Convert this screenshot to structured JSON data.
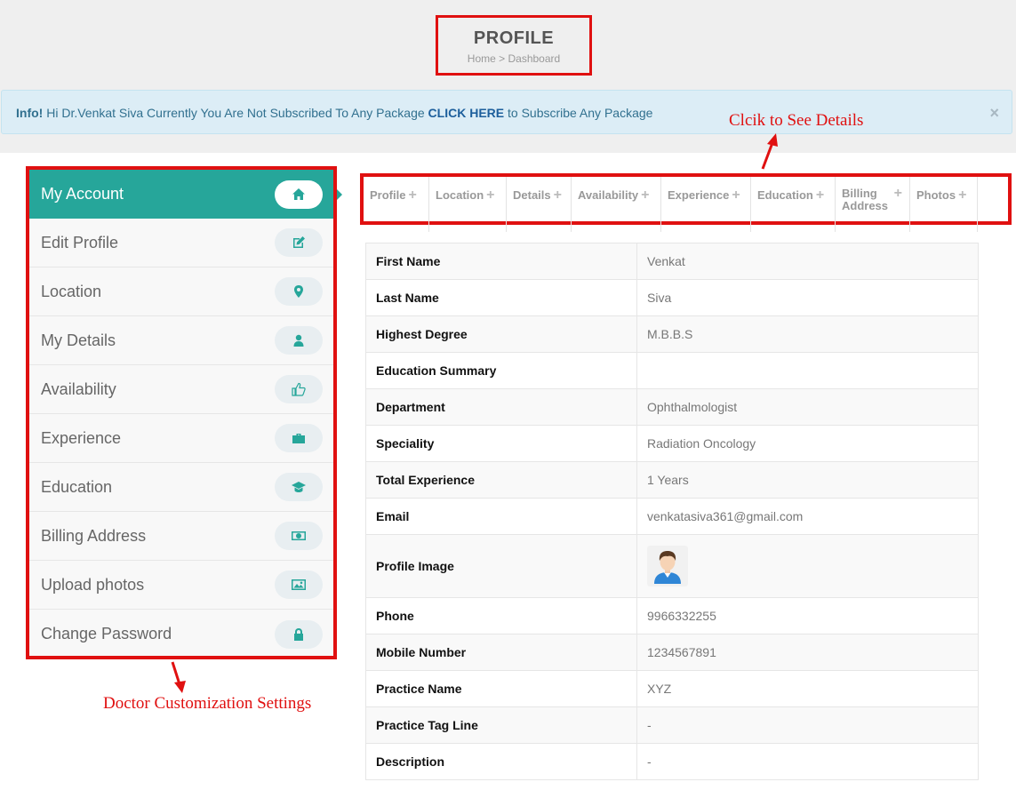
{
  "header": {
    "title": "PROFILE",
    "breadcrumb": "Home > Dashboard"
  },
  "alert": {
    "prefix": "Info!",
    "message_before": " Hi Dr.Venkat Siva Currently You Are Not Subscribed To Any Package ",
    "link": "CLICK HERE",
    "message_after": "  to Subscribe Any Package",
    "close": "×"
  },
  "annotations": {
    "tabs_note": "Clcik to See Details",
    "sidebar_note": "Doctor Customization Settings",
    "color": "#e01010"
  },
  "sidebar": {
    "items": [
      {
        "label": "My Account",
        "icon": "home-icon"
      },
      {
        "label": "Edit Profile",
        "icon": "edit-icon"
      },
      {
        "label": "Location",
        "icon": "map-marker-icon"
      },
      {
        "label": "My Details",
        "icon": "user-icon"
      },
      {
        "label": "Availability",
        "icon": "thumbs-up-icon"
      },
      {
        "label": "Experience",
        "icon": "briefcase-icon"
      },
      {
        "label": "Education",
        "icon": "graduation-cap-icon"
      },
      {
        "label": "Billing Address",
        "icon": "money-icon"
      },
      {
        "label": "Upload photos",
        "icon": "picture-icon"
      },
      {
        "label": "Change Password",
        "icon": "lock-icon"
      }
    ]
  },
  "tabs": [
    {
      "label": "Profile",
      "plus": "+"
    },
    {
      "label": "Location",
      "plus": "+"
    },
    {
      "label": "Details",
      "plus": "+"
    },
    {
      "label": "Availability",
      "plus": "+"
    },
    {
      "label": "Experience",
      "plus": "+"
    },
    {
      "label": "Education",
      "plus": "+"
    },
    {
      "label": "Billing",
      "label2": "Address",
      "plus": "+"
    },
    {
      "label": "Photos",
      "plus": "+"
    }
  ],
  "profile": {
    "rows": [
      {
        "key": "First Name",
        "value": "Venkat"
      },
      {
        "key": "Last Name",
        "value": "Siva"
      },
      {
        "key": "Highest Degree",
        "value": "M.B.B.S"
      },
      {
        "key": "Education Summary",
        "value": ""
      },
      {
        "key": "Department",
        "value": "Ophthalmologist"
      },
      {
        "key": "Speciality",
        "value": "Radiation Oncology"
      },
      {
        "key": "Total Experience",
        "value": "1 Years"
      },
      {
        "key": "Email",
        "value": "venkatasiva361@gmail.com"
      },
      {
        "key": "Profile Image",
        "value": ""
      },
      {
        "key": "Phone",
        "value": "9966332255"
      },
      {
        "key": "Mobile Number",
        "value": "1234567891"
      },
      {
        "key": "Practice Name",
        "value": "XYZ"
      },
      {
        "key": "Practice Tag Line",
        "value": "-"
      },
      {
        "key": "Description",
        "value": "-"
      }
    ]
  },
  "colors": {
    "accent": "#26a69a",
    "highlight_border": "#e01010",
    "alert_bg": "#dcedf6"
  }
}
